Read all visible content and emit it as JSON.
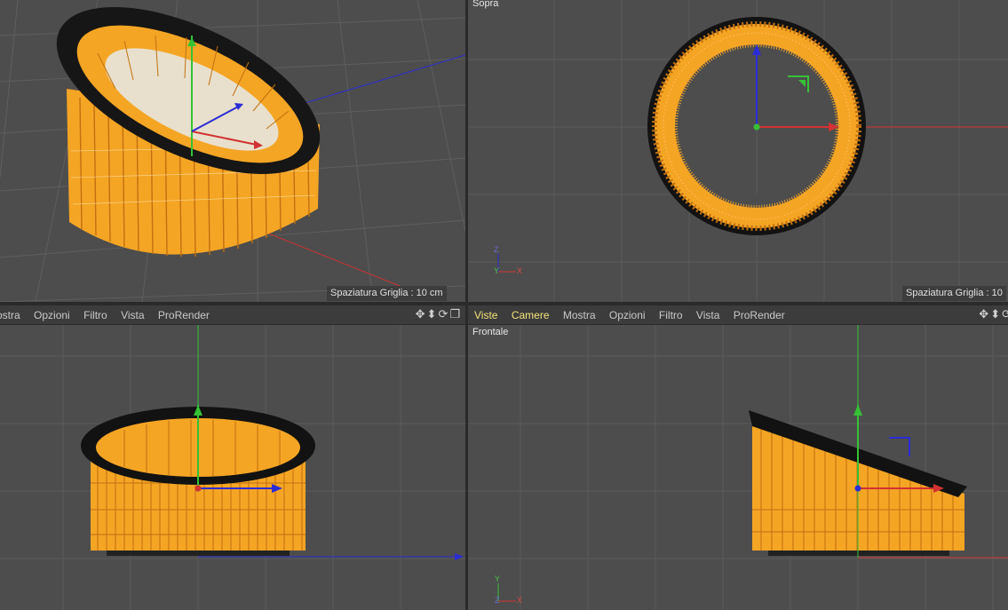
{
  "colors": {
    "viewport_bg": "#4d4d4d",
    "wire_orange": "#f5a524",
    "rim_black": "#121212",
    "axis_green": "#35c235",
    "axis_red": "#d23232",
    "axis_blue": "#2c2cd6",
    "menu_highlight": "#f3e27a"
  },
  "viewports": {
    "perspective": {
      "grid_info": "Spaziatura Griglia : 10 cm"
    },
    "top": {
      "label": "Sopra",
      "grid_info": "Spaziatura Griglia : 10",
      "axis_a": "Z",
      "axis_b": "Y",
      "axis_c": "X"
    },
    "left_bottom": {
      "menu": [
        "ostra",
        "Opzioni",
        "Filtro",
        "Vista",
        "ProRender"
      ]
    },
    "front": {
      "label": "Frontale",
      "menu": [
        "Viste",
        "Camere",
        "Mostra",
        "Opzioni",
        "Filtro",
        "Vista",
        "ProRender"
      ],
      "axis_a": "Y",
      "axis_b": "Z",
      "axis_c": "X"
    }
  },
  "nav_icons": [
    "move-icon",
    "zoom-icon",
    "rotate-icon",
    "maximize-icon"
  ]
}
